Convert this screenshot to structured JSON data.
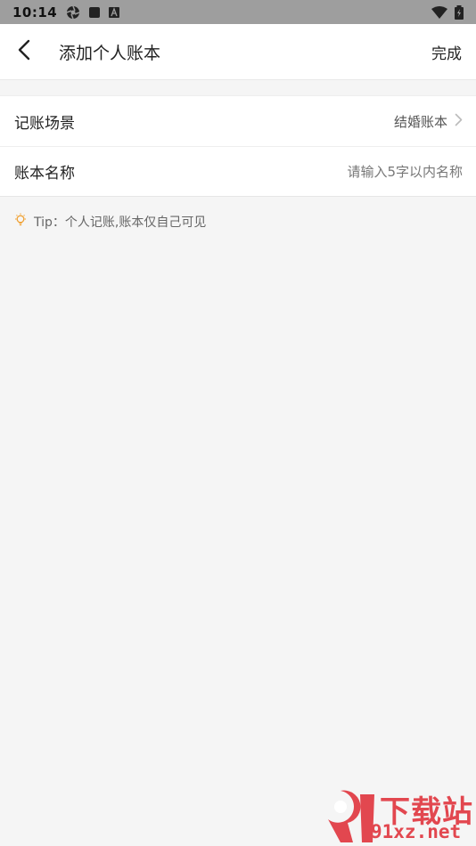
{
  "status_bar": {
    "time": "10:14",
    "icons": [
      "aperture-icon",
      "square-notification-icon",
      "a-notification-icon",
      "wifi-icon",
      "battery-charging-icon"
    ]
  },
  "header": {
    "title": "添加个人账本",
    "done_label": "完成",
    "back_icon": "chevron-left-icon"
  },
  "form": {
    "scene": {
      "label": "记账场景",
      "value": "结婚账本"
    },
    "name": {
      "label": "账本名称",
      "placeholder": "请输入5字以内名称",
      "value": ""
    }
  },
  "tip": {
    "text": "Tip：个人记账,账本仅自己可见",
    "icon": "lightbulb-icon",
    "icon_color": "#f0a030"
  },
  "watermark": {
    "top_text": "下载站",
    "bottom_text": "91xz.net",
    "color": "#e2474f"
  }
}
